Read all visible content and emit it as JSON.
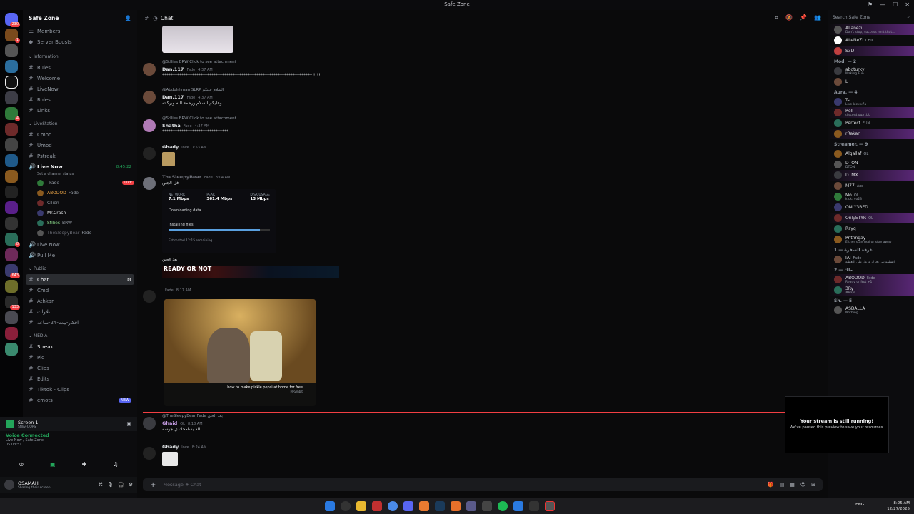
{
  "window": {
    "title": "Safe Zone"
  },
  "server": {
    "name": "Safe Zone",
    "top_items": [
      "Members",
      "Server Boosts"
    ]
  },
  "categories": {
    "information": "Information",
    "livestation": "LiveStation",
    "public": "Public",
    "media": "MEDIA"
  },
  "channels": {
    "information": [
      "Rules",
      "Welcome",
      "LiveNow",
      "Roles",
      "Links"
    ],
    "livestation": [
      "Cmod",
      "Umod",
      "Pstreak"
    ],
    "live_now": {
      "name": "Live Now",
      "timer": "8:45:22",
      "status": "Set a channel status",
      "users": [
        {
          "name": "",
          "tag": "Fade",
          "live": "LIVE"
        },
        {
          "name": "ABODOD",
          "tag": "Fade"
        },
        {
          "name": "Cllien"
        },
        {
          "name": "Mr.Crash"
        },
        {
          "name": "Stllies",
          "tag": "BRW"
        },
        {
          "name": "TheSleepyBear",
          "tag": "Fade"
        }
      ]
    },
    "extra_voice": [
      "Live Now",
      "Pull Me"
    ],
    "public": [
      "Chat",
      "Cmd",
      "Athkar",
      "تلاوات",
      "افكار-بيت-24-ساعه"
    ],
    "media": [
      "Streak",
      "Pic",
      "Clips",
      "Edits",
      "Tiktok - Clips",
      "emots"
    ],
    "new_tag": "NEW"
  },
  "voice_panel": {
    "screen_label": "Screen 1",
    "screen_sub": "Stlliy-OOPS",
    "connected": "Voice Connected",
    "location": "Live Now / Safe Zone",
    "elapsed": "05:03:51"
  },
  "user": {
    "name": "OSAMAH",
    "status": "Sharing their screen"
  },
  "chat": {
    "channel": "Chat",
    "placeholder": "Message # Chat",
    "messages": [
      {
        "reply": "@Stllies  BRW  Click to see attachment",
        "author": "Dan.117",
        "tag": "Fade",
        "time": "4:37 AM",
        "text": "**********************************************************************  !!!!!"
      },
      {
        "reply": "@Abdulrhman  SLRP  السلام عليكم",
        "author": "Dan.117",
        "tag": "Fade",
        "time": "4:37 AM",
        "text": "وعليكم السلام ورحمة الله وبركاته"
      },
      {
        "reply": "@Stllies  BRW  Click to see attachment",
        "author": "Shatha",
        "tag": "Fade",
        "time": "4:37 AM",
        "text": "*******************************"
      },
      {
        "author": "Ghady",
        "tag": "love",
        "time": "7:53 AM"
      },
      {
        "author": "TheSleepyBear",
        "tag": "Fade",
        "time": "8:04 AM",
        "text": "فل الجين"
      },
      {
        "author": "",
        "tag": "Fade",
        "time": "8:17 AM",
        "text": "بعد الحين"
      },
      {
        "reply": "@TheSleepyBear  Fade  بعد الحين",
        "author": "Ghaid",
        "tag": "OL",
        "time": "8:18 AM",
        "text": "الله يسامحك ي جوسه"
      },
      {
        "author": "Ghady",
        "tag": "love",
        "time": "8:24 AM"
      }
    ],
    "download_card": {
      "network_label": "NETWORK",
      "network_value": "7.1 Mbps",
      "peak_label": "PEAK",
      "peak_value": "361.4 Mbps",
      "disk_label": "DISK USAGE",
      "disk_value": "13 Mbps",
      "downloading": "Downloading data",
      "installing": "Installing files",
      "remaining": "Estimated 12:15 remaining",
      "progress": 0.9
    },
    "banner_text": "READY OR NOT",
    "video": {
      "caption": "how to make pickle pepsi at home for free",
      "channel": "MRymbit"
    }
  },
  "members": {
    "search_placeholder": "Search Safe Zone",
    "top": [
      {
        "name": "ALanezi",
        "sub": "Don't stop, success isn't that...",
        "boost": true
      },
      {
        "name": "ALeNeZi",
        "tag": "CHIL"
      },
      {
        "name": "S3D",
        "boost": true
      }
    ],
    "groups": [
      {
        "title": "Mod. — 2",
        "items": [
          {
            "name": "aboturky",
            "sub": "Making Fun"
          },
          {
            "name": "L"
          }
        ]
      },
      {
        "title": "Aura. — 4",
        "items": [
          {
            "name": "Ts",
            "sub": "Live kick x7a"
          },
          {
            "name": "Rell",
            "sub": "discord.gg/rtUU",
            "boost": true
          },
          {
            "name": "Perfect",
            "tag": "FUN"
          },
          {
            "name": "rRakan",
            "boost": true
          }
        ]
      },
      {
        "title": "Streamer. — 9",
        "items": [
          {
            "name": "Alqallaf",
            "tag": "OL"
          },
          {
            "name": "DTON",
            "sub": "DTON"
          },
          {
            "name": "DTMX",
            "boost": true
          },
          {
            "name": "M77",
            "tag": "Axe"
          },
          {
            "name": "Mo",
            "tag": "OL",
            "sub": "kick: vo23"
          },
          {
            "name": "ONLY3BED"
          },
          {
            "name": "Only5TYR",
            "tag": "OL",
            "boost": true
          },
          {
            "name": "Rsyq"
          },
          {
            "name": "Pntnngay",
            "sub": "Either stay real or stay away"
          }
        ]
      },
      {
        "title": "غرفة السفرة — 1",
        "items": [
          {
            "name": "IAI",
            "tag": "Fade",
            "sub": "اتسلمو نبي بحرك عزول على التغطية"
          }
        ]
      },
      {
        "title": "ملك — 2",
        "items": [
          {
            "name": "ABODOD",
            "tag": "Fade",
            "sub": "Ready or Not +1",
            "boost": true
          },
          {
            "name": "3Ry",
            "sub": "#Rayl",
            "boost": true
          }
        ]
      },
      {
        "title": "Sh. — 5",
        "items": [
          {
            "name": "ASDALLA",
            "sub": "Nothing."
          }
        ]
      }
    ]
  },
  "toast": {
    "title": "Your stream is still running!",
    "body": "We've paused this preview to save your resources."
  },
  "taskbar": {
    "lang": "ENG",
    "time": "8:25 AM",
    "date": "12/27/2025"
  },
  "colors": {
    "accent": "#5865f2",
    "live": "#f23f43",
    "boost": "#9b59b6",
    "online": "#23a55a"
  }
}
